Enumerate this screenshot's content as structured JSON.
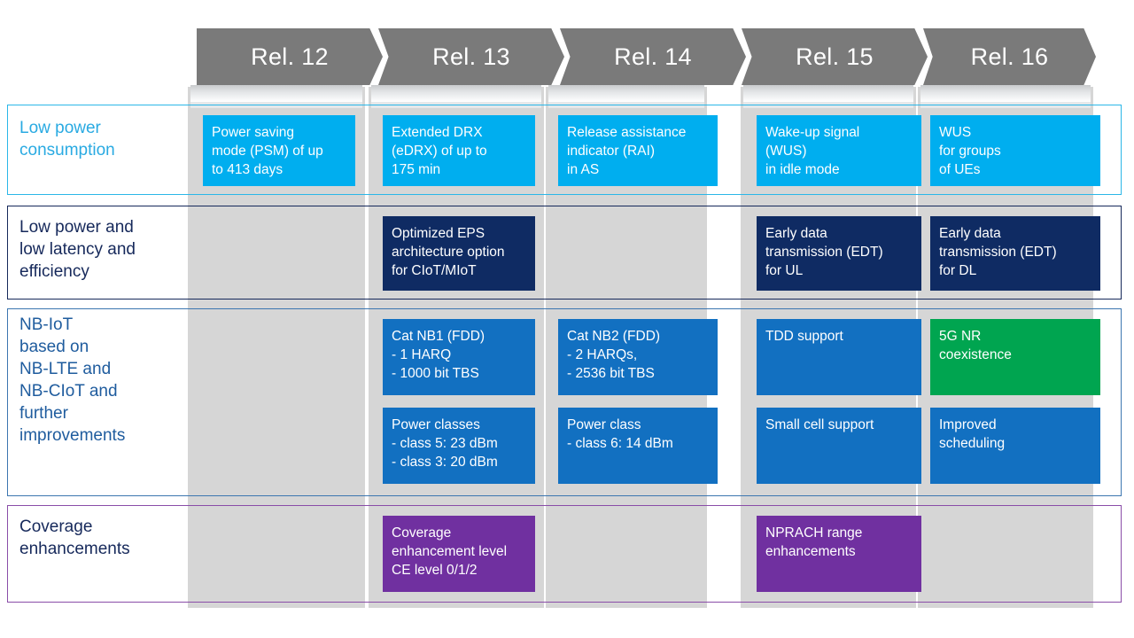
{
  "palette": {
    "header_gray": "#7a7a7a",
    "band_gray": "#d6d6d6",
    "cyan": "#00AEEF",
    "navy": "#0F2B63",
    "blue": "#1270C1",
    "green": "#00A550",
    "purple": "#7030A0",
    "row1_border": "#2BB7E8",
    "row2_border": "#16295B",
    "row3_border": "#3C76B0",
    "row4_border": "#8A4DA8",
    "row1_label_color": "#29AAE2",
    "row2_label_color": "#16295B",
    "row3_label_color": "#1F5C9E",
    "row4_label_color": "#16295B",
    "white": "#ffffff"
  },
  "header": {
    "releases": [
      {
        "label": "Rel. 12"
      },
      {
        "label": "Rel. 13"
      },
      {
        "label": "Rel. 14"
      },
      {
        "label": "Rel. 15"
      },
      {
        "label": "Rel. 16"
      }
    ]
  },
  "rows": [
    {
      "label": "Low power\nconsumption",
      "cells": [
        {
          "text": "Power saving\nmode (PSM) of up\nto 413 days",
          "color": "cyan"
        },
        {
          "text": "Extended DRX\n(eDRX) of up to\n175 min",
          "color": "cyan"
        },
        {
          "text": "Release assistance\nindicator (RAI)\nin AS",
          "color": "cyan"
        },
        {
          "text": "Wake-up signal\n(WUS)\nin idle mode",
          "color": "cyan"
        },
        {
          "text": "WUS\nfor groups\nof UEs",
          "color": "cyan"
        }
      ]
    },
    {
      "label": "Low power and\nlow latency and\nefficiency",
      "cells": [
        {
          "text": "",
          "color": "none"
        },
        {
          "text": "Optimized EPS\narchitecture option\nfor CIoT/MIoT",
          "color": "navy"
        },
        {
          "text": "",
          "color": "none"
        },
        {
          "text": "Early data\ntransmission (EDT)\nfor UL",
          "color": "navy"
        },
        {
          "text": "Early data\ntransmission (EDT)\nfor DL",
          "color": "navy"
        }
      ]
    },
    {
      "label": "NB-IoT\nbased on\nNB-LTE and\nNB-CIoT and\nfurther\nimprovements",
      "cells_top": [
        {
          "text": "",
          "color": "none"
        },
        {
          "text": "Cat NB1 (FDD)\n- 1 HARQ\n- 1000 bit TBS",
          "color": "blue"
        },
        {
          "text": "Cat NB2 (FDD)\n- 2 HARQs,\n- 2536 bit TBS",
          "color": "blue"
        },
        {
          "text": "TDD support",
          "color": "blue"
        },
        {
          "text": "5G NR\ncoexistence",
          "color": "green"
        }
      ],
      "cells_bottom": [
        {
          "text": "",
          "color": "none"
        },
        {
          "text": "Power classes\n- class 5: 23 dBm\n- class 3: 20 dBm",
          "color": "blue"
        },
        {
          "text": "Power class\n- class 6: 14 dBm",
          "color": "blue"
        },
        {
          "text": "Small cell support",
          "color": "blue"
        },
        {
          "text": "Improved\nscheduling",
          "color": "blue"
        }
      ]
    },
    {
      "label": "Coverage\nenhancements",
      "cells": [
        {
          "text": "",
          "color": "none"
        },
        {
          "text": "Coverage\nenhancement level\nCE level 0/1/2",
          "color": "purple"
        },
        {
          "text": "",
          "color": "none"
        },
        {
          "text": "NPRACH range\nenhancements",
          "color": "purple"
        },
        {
          "text": "",
          "color": "none"
        }
      ]
    }
  ]
}
